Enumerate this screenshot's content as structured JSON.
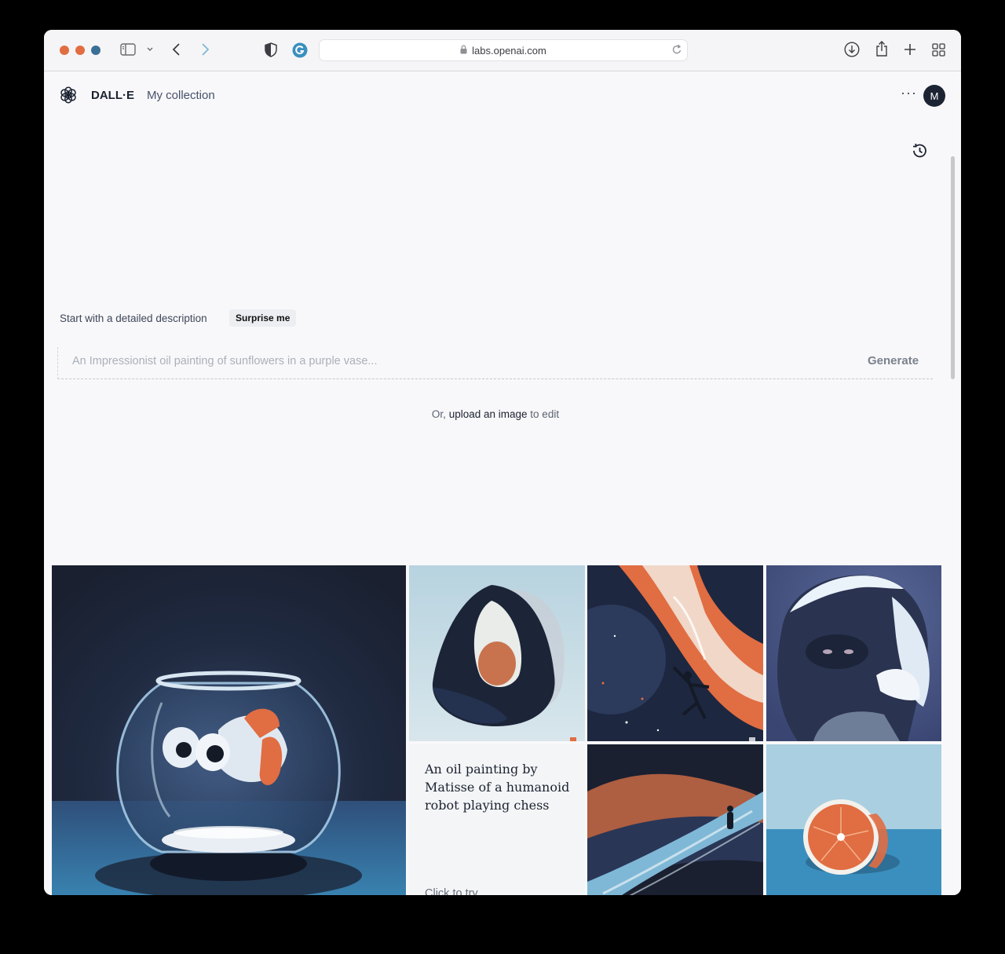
{
  "browser": {
    "url": "labs.openai.com",
    "icons": {
      "sidebar": "sidebar-toggle-icon",
      "back": "chevron-left-icon",
      "forward": "chevron-right-icon",
      "privacy": "shield-icon",
      "extension": "grammarly-icon",
      "lock": "lock-icon",
      "reload": "reload-icon",
      "downloads": "download-icon",
      "share": "share-icon",
      "new_tab": "plus-icon",
      "tab_overview": "grid-icon"
    },
    "traffic_light_colors": [
      "#e16d42",
      "#e16d42",
      "#3b6f96"
    ]
  },
  "header": {
    "brand": "DALL·E",
    "nav": "My collection",
    "more": "···",
    "avatar_initial": "M"
  },
  "prompt": {
    "label": "Start with a detailed description",
    "surprise_button": "Surprise me",
    "placeholder": "An Impressionist oil painting of sunflowers in a purple vase...",
    "generate_button": "Generate"
  },
  "upload": {
    "prefix": "Or,",
    "link": "upload an image",
    "suffix": "to edit"
  },
  "gallery": {
    "tiles": [
      "fishbowl-image",
      "avocado-chair-image",
      "space-dancer-image",
      "yeti-portrait-image",
      "prompt-card",
      "desert-dunes-image",
      "orange-half-image"
    ],
    "prompt_card": {
      "text": "An oil painting by Matisse of a humanoid robot playing chess",
      "cta": "Click to try"
    }
  },
  "colors": {
    "accent_orange": "#e16d42",
    "navy": "#1c2434",
    "blue": "#3b8fbe"
  }
}
